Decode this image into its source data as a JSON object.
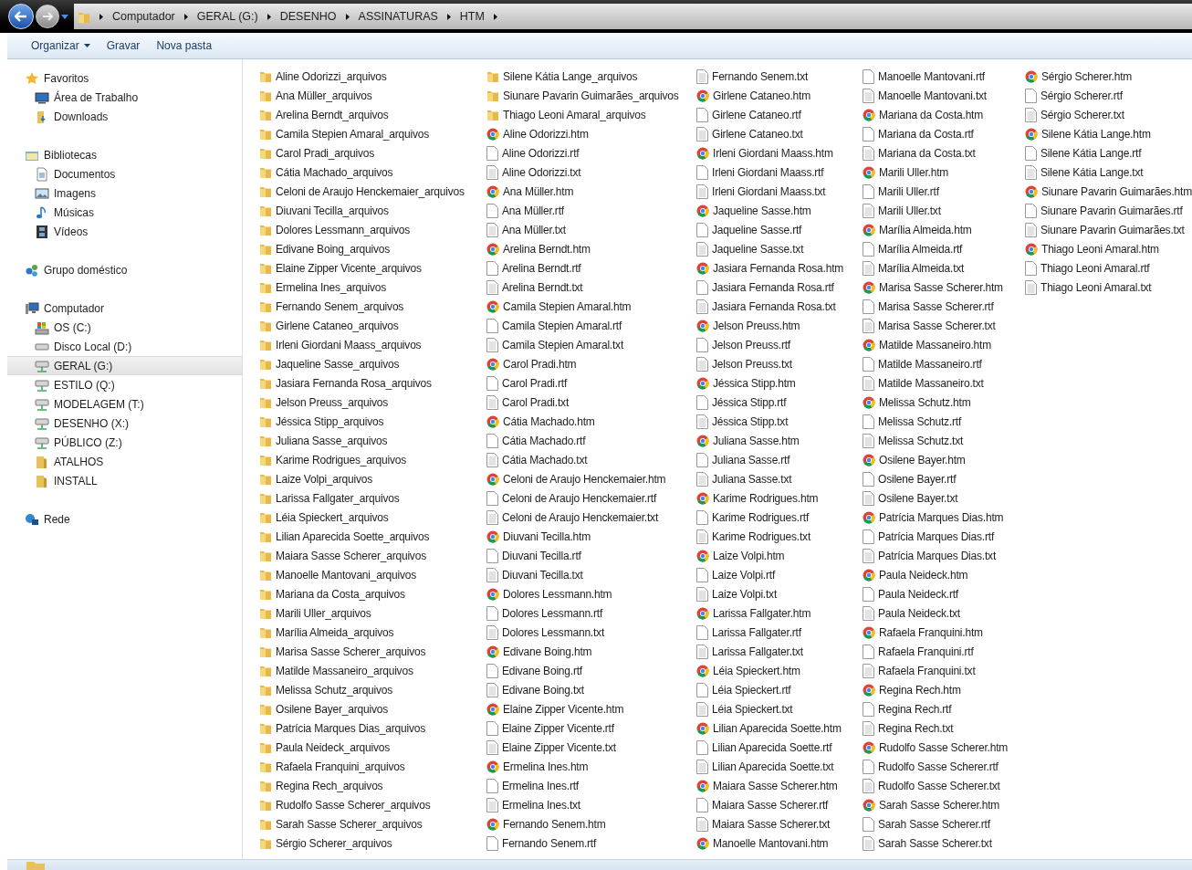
{
  "breadcrumb": [
    "Computador",
    "GERAL (G:)",
    "DESENHO",
    "ASSINATURAS",
    "HTM"
  ],
  "toolbar": [
    {
      "label": "Organizar",
      "kind": "menu"
    },
    {
      "label": "Gravar",
      "kind": "plain"
    },
    {
      "label": "Nova pasta",
      "kind": "plain"
    }
  ],
  "sidebar": [
    {
      "label": "Favoritos",
      "kind": "star",
      "selected": false,
      "children": [
        {
          "label": "Área de Trabalho",
          "kind": "desktop",
          "selected": false
        },
        {
          "label": "Downloads",
          "kind": "downloads",
          "selected": false
        }
      ]
    },
    {
      "label": "Bibliotecas",
      "kind": "library",
      "selected": false,
      "children": [
        {
          "label": "Documentos",
          "kind": "document",
          "selected": false
        },
        {
          "label": "Imagens",
          "kind": "image",
          "selected": false
        },
        {
          "label": "Músicas",
          "kind": "music",
          "selected": false
        },
        {
          "label": "Vídeos",
          "kind": "video",
          "selected": false
        }
      ]
    },
    {
      "label": "Grupo doméstico",
      "kind": "homegroup",
      "selected": false
    },
    {
      "label": "Computador",
      "kind": "computer",
      "selected": false,
      "children": [
        {
          "label": "OS (C:)",
          "kind": "osdrive",
          "selected": false
        },
        {
          "label": "Disco Local (D:)",
          "kind": "drive",
          "selected": false
        },
        {
          "label": "GERAL (G:)",
          "kind": "netdrive",
          "selected": true
        },
        {
          "label": "ESTILO (Q:)",
          "kind": "netdrive",
          "selected": false
        },
        {
          "label": "MODELAGEM (T:)",
          "kind": "netdrive",
          "selected": false
        },
        {
          "label": "DESENHO (X:)",
          "kind": "netdrive",
          "selected": false
        },
        {
          "label": "PÚBLICO (Z:)",
          "kind": "netdrive",
          "selected": false
        },
        {
          "label": "ATALHOS",
          "kind": "folder",
          "selected": false
        },
        {
          "label": "INSTALL",
          "kind": "folder",
          "selected": false
        }
      ]
    },
    {
      "label": "Rede",
      "kind": "network",
      "selected": false
    }
  ],
  "files": [
    {
      "name": "Aline Odorizzi_arquivos",
      "kind": "folder"
    },
    {
      "name": "Ana Müller_arquivos",
      "kind": "folder"
    },
    {
      "name": "Arelina Berndt_arquivos",
      "kind": "folder"
    },
    {
      "name": "Camila Stepien Amaral_arquivos",
      "kind": "folder"
    },
    {
      "name": "Carol Pradi_arquivos",
      "kind": "folder"
    },
    {
      "name": "Cátia Machado_arquivos",
      "kind": "folder"
    },
    {
      "name": "Celoni de Araujo Henckemaier_arquivos",
      "kind": "folder"
    },
    {
      "name": "Diuvani Tecilla_arquivos",
      "kind": "folder"
    },
    {
      "name": "Dolores Lessmann_arquivos",
      "kind": "folder"
    },
    {
      "name": "Edivane Boing_arquivos",
      "kind": "folder"
    },
    {
      "name": "Elaine Zipper Vicente_arquivos",
      "kind": "folder"
    },
    {
      "name": "Ermelina Ines_arquivos",
      "kind": "folder"
    },
    {
      "name": "Fernando Senem_arquivos",
      "kind": "folder"
    },
    {
      "name": "Girlene Cataneo_arquivos",
      "kind": "folder"
    },
    {
      "name": "Irleni Giordani Maass_arquivos",
      "kind": "folder"
    },
    {
      "name": "Jaqueline Sasse_arquivos",
      "kind": "folder"
    },
    {
      "name": "Jasiara Fernanda Rosa_arquivos",
      "kind": "folder"
    },
    {
      "name": "Jelson Preuss_arquivos",
      "kind": "folder"
    },
    {
      "name": "Jéssica Stipp_arquivos",
      "kind": "folder"
    },
    {
      "name": "Juliana Sasse_arquivos",
      "kind": "folder"
    },
    {
      "name": "Karime Rodrigues_arquivos",
      "kind": "folder"
    },
    {
      "name": "Laize Volpi_arquivos",
      "kind": "folder"
    },
    {
      "name": "Larissa Fallgater_arquivos",
      "kind": "folder"
    },
    {
      "name": "Léia Spieckert_arquivos",
      "kind": "folder"
    },
    {
      "name": "Lilian Aparecida Soette_arquivos",
      "kind": "folder"
    },
    {
      "name": "Maiara Sasse Scherer_arquivos",
      "kind": "folder"
    },
    {
      "name": "Manoelle Mantovani_arquivos",
      "kind": "folder"
    },
    {
      "name": "Mariana da Costa_arquivos",
      "kind": "folder"
    },
    {
      "name": "Marili Uller_arquivos",
      "kind": "folder"
    },
    {
      "name": "Marília Almeida_arquivos",
      "kind": "folder"
    },
    {
      "name": "Marisa Sasse Scherer_arquivos",
      "kind": "folder"
    },
    {
      "name": "Matilde Massaneiro_arquivos",
      "kind": "folder"
    },
    {
      "name": "Melissa Schutz_arquivos",
      "kind": "folder"
    },
    {
      "name": "Osilene Bayer_arquivos",
      "kind": "folder"
    },
    {
      "name": "Patrícia Marques Dias_arquivos",
      "kind": "folder"
    },
    {
      "name": "Paula Neideck_arquivos",
      "kind": "folder"
    },
    {
      "name": "Rafaela Franquini_arquivos",
      "kind": "folder"
    },
    {
      "name": "Regina Rech_arquivos",
      "kind": "folder"
    },
    {
      "name": "Rudolfo Sasse Scherer_arquivos",
      "kind": "folder"
    },
    {
      "name": "Sarah Sasse Scherer_arquivos",
      "kind": "folder"
    },
    {
      "name": "Sérgio Scherer_arquivos",
      "kind": "folder"
    },
    {
      "name": "Silene Kátia Lange_arquivos",
      "kind": "folder"
    },
    {
      "name": "Siunare Pavarin Guimarães_arquivos",
      "kind": "folder"
    },
    {
      "name": "Thiago Leoni Amaral_arquivos",
      "kind": "folder"
    },
    {
      "name": "Aline Odorizzi.htm",
      "kind": "htm"
    },
    {
      "name": "Aline Odorizzi.rtf",
      "kind": "rtf"
    },
    {
      "name": "Aline Odorizzi.txt",
      "kind": "txt"
    },
    {
      "name": "Ana Müller.htm",
      "kind": "htm"
    },
    {
      "name": "Ana Müller.rtf",
      "kind": "rtf"
    },
    {
      "name": "Ana Müller.txt",
      "kind": "txt"
    },
    {
      "name": "Arelina Berndt.htm",
      "kind": "htm"
    },
    {
      "name": "Arelina Berndt.rtf",
      "kind": "rtf"
    },
    {
      "name": "Arelina Berndt.txt",
      "kind": "txt"
    },
    {
      "name": "Camila Stepien Amaral.htm",
      "kind": "htm"
    },
    {
      "name": "Camila Stepien Amaral.rtf",
      "kind": "rtf"
    },
    {
      "name": "Camila Stepien Amaral.txt",
      "kind": "txt"
    },
    {
      "name": "Carol Pradi.htm",
      "kind": "htm"
    },
    {
      "name": "Carol Pradi.rtf",
      "kind": "rtf"
    },
    {
      "name": "Carol Pradi.txt",
      "kind": "txt"
    },
    {
      "name": "Cátia Machado.htm",
      "kind": "htm"
    },
    {
      "name": "Cátia Machado.rtf",
      "kind": "rtf"
    },
    {
      "name": "Cátia Machado.txt",
      "kind": "txt"
    },
    {
      "name": "Celoni de Araujo Henckemaier.htm",
      "kind": "htm"
    },
    {
      "name": "Celoni de Araujo Henckemaier.rtf",
      "kind": "rtf"
    },
    {
      "name": "Celoni de Araujo Henckemaier.txt",
      "kind": "txt"
    },
    {
      "name": "Diuvani Tecilla.htm",
      "kind": "htm"
    },
    {
      "name": "Diuvani Tecilla.rtf",
      "kind": "rtf"
    },
    {
      "name": "Diuvani Tecilla.txt",
      "kind": "txt"
    },
    {
      "name": "Dolores Lessmann.htm",
      "kind": "htm"
    },
    {
      "name": "Dolores Lessmann.rtf",
      "kind": "rtf"
    },
    {
      "name": "Dolores Lessmann.txt",
      "kind": "txt"
    },
    {
      "name": "Edivane Boing.htm",
      "kind": "htm"
    },
    {
      "name": "Edivane Boing.rtf",
      "kind": "rtf"
    },
    {
      "name": "Edivane Boing.txt",
      "kind": "txt"
    },
    {
      "name": "Elaine Zipper Vicente.htm",
      "kind": "htm"
    },
    {
      "name": "Elaine Zipper Vicente.rtf",
      "kind": "rtf"
    },
    {
      "name": "Elaine Zipper Vicente.txt",
      "kind": "txt"
    },
    {
      "name": "Ermelina Ines.htm",
      "kind": "htm"
    },
    {
      "name": "Ermelina Ines.rtf",
      "kind": "rtf"
    },
    {
      "name": "Ermelina Ines.txt",
      "kind": "txt"
    },
    {
      "name": "Fernando Senem.htm",
      "kind": "htm"
    },
    {
      "name": "Fernando Senem.rtf",
      "kind": "rtf"
    },
    {
      "name": "Fernando Senem.txt",
      "kind": "txt"
    },
    {
      "name": "Girlene Cataneo.htm",
      "kind": "htm"
    },
    {
      "name": "Girlene Cataneo.rtf",
      "kind": "rtf"
    },
    {
      "name": "Girlene Cataneo.txt",
      "kind": "txt"
    },
    {
      "name": "Irleni Giordani Maass.htm",
      "kind": "htm"
    },
    {
      "name": "Irleni Giordani Maass.rtf",
      "kind": "rtf"
    },
    {
      "name": "Irleni Giordani Maass.txt",
      "kind": "txt"
    },
    {
      "name": "Jaqueline Sasse.htm",
      "kind": "htm"
    },
    {
      "name": "Jaqueline Sasse.rtf",
      "kind": "rtf"
    },
    {
      "name": "Jaqueline Sasse.txt",
      "kind": "txt"
    },
    {
      "name": "Jasiara Fernanda Rosa.htm",
      "kind": "htm"
    },
    {
      "name": "Jasiara Fernanda Rosa.rtf",
      "kind": "rtf"
    },
    {
      "name": "Jasiara Fernanda Rosa.txt",
      "kind": "txt"
    },
    {
      "name": "Jelson Preuss.htm",
      "kind": "htm"
    },
    {
      "name": "Jelson Preuss.rtf",
      "kind": "rtf"
    },
    {
      "name": "Jelson Preuss.txt",
      "kind": "txt"
    },
    {
      "name": "Jéssica Stipp.htm",
      "kind": "htm"
    },
    {
      "name": "Jéssica Stipp.rtf",
      "kind": "rtf"
    },
    {
      "name": "Jéssica Stipp.txt",
      "kind": "txt"
    },
    {
      "name": "Juliana Sasse.htm",
      "kind": "htm"
    },
    {
      "name": "Juliana Sasse.rtf",
      "kind": "rtf"
    },
    {
      "name": "Juliana Sasse.txt",
      "kind": "txt"
    },
    {
      "name": "Karime Rodrigues.htm",
      "kind": "htm"
    },
    {
      "name": "Karime Rodrigues.rtf",
      "kind": "rtf"
    },
    {
      "name": "Karime Rodrigues.txt",
      "kind": "txt"
    },
    {
      "name": "Laize Volpi.htm",
      "kind": "htm"
    },
    {
      "name": "Laize Volpi.rtf",
      "kind": "rtf"
    },
    {
      "name": "Laize Volpi.txt",
      "kind": "txt"
    },
    {
      "name": "Larissa Fallgater.htm",
      "kind": "htm"
    },
    {
      "name": "Larissa Fallgater.rtf",
      "kind": "rtf"
    },
    {
      "name": "Larissa Fallgater.txt",
      "kind": "txt"
    },
    {
      "name": "Léia Spieckert.htm",
      "kind": "htm"
    },
    {
      "name": "Léia Spieckert.rtf",
      "kind": "rtf"
    },
    {
      "name": "Léia Spieckert.txt",
      "kind": "txt"
    },
    {
      "name": "Lilian Aparecida Soette.htm",
      "kind": "htm"
    },
    {
      "name": "Lilian Aparecida Soette.rtf",
      "kind": "rtf"
    },
    {
      "name": "Lilian Aparecida Soette.txt",
      "kind": "txt"
    },
    {
      "name": "Maiara Sasse Scherer.htm",
      "kind": "htm"
    },
    {
      "name": "Maiara Sasse Scherer.rtf",
      "kind": "rtf"
    },
    {
      "name": "Maiara Sasse Scherer.txt",
      "kind": "txt"
    },
    {
      "name": "Manoelle Mantovani.htm",
      "kind": "htm"
    },
    {
      "name": "Manoelle Mantovani.rtf",
      "kind": "rtf"
    },
    {
      "name": "Manoelle Mantovani.txt",
      "kind": "txt"
    },
    {
      "name": "Mariana da Costa.htm",
      "kind": "htm"
    },
    {
      "name": "Mariana da Costa.rtf",
      "kind": "rtf"
    },
    {
      "name": "Mariana da Costa.txt",
      "kind": "txt"
    },
    {
      "name": "Marili Uller.htm",
      "kind": "htm"
    },
    {
      "name": "Marili Uller.rtf",
      "kind": "rtf"
    },
    {
      "name": "Marili Uller.txt",
      "kind": "txt"
    },
    {
      "name": "Marília Almeida.htm",
      "kind": "htm"
    },
    {
      "name": "Marília Almeida.rtf",
      "kind": "rtf"
    },
    {
      "name": "Marília Almeida.txt",
      "kind": "txt"
    },
    {
      "name": "Marisa Sasse Scherer.htm",
      "kind": "htm"
    },
    {
      "name": "Marisa Sasse Scherer.rtf",
      "kind": "rtf"
    },
    {
      "name": "Marisa Sasse Scherer.txt",
      "kind": "txt"
    },
    {
      "name": "Matilde Massaneiro.htm",
      "kind": "htm"
    },
    {
      "name": "Matilde Massaneiro.rtf",
      "kind": "rtf"
    },
    {
      "name": "Matilde Massaneiro.txt",
      "kind": "txt"
    },
    {
      "name": "Melissa Schutz.htm",
      "kind": "htm"
    },
    {
      "name": "Melissa Schutz.rtf",
      "kind": "rtf"
    },
    {
      "name": "Melissa Schutz.txt",
      "kind": "txt"
    },
    {
      "name": "Osilene Bayer.htm",
      "kind": "htm"
    },
    {
      "name": "Osilene Bayer.rtf",
      "kind": "rtf"
    },
    {
      "name": "Osilene Bayer.txt",
      "kind": "txt"
    },
    {
      "name": "Patrícia Marques Dias.htm",
      "kind": "htm"
    },
    {
      "name": "Patrícia Marques Dias.rtf",
      "kind": "rtf"
    },
    {
      "name": "Patrícia Marques Dias.txt",
      "kind": "txt"
    },
    {
      "name": "Paula Neideck.htm",
      "kind": "htm"
    },
    {
      "name": "Paula Neideck.rtf",
      "kind": "rtf"
    },
    {
      "name": "Paula Neideck.txt",
      "kind": "txt"
    },
    {
      "name": "Rafaela Franquini.htm",
      "kind": "htm"
    },
    {
      "name": "Rafaela Franquini.rtf",
      "kind": "rtf"
    },
    {
      "name": "Rafaela Franquini.txt",
      "kind": "txt"
    },
    {
      "name": "Regina Rech.htm",
      "kind": "htm"
    },
    {
      "name": "Regina Rech.rtf",
      "kind": "rtf"
    },
    {
      "name": "Regina Rech.txt",
      "kind": "txt"
    },
    {
      "name": "Rudolfo Sasse Scherer.htm",
      "kind": "htm"
    },
    {
      "name": "Rudolfo Sasse Scherer.rtf",
      "kind": "rtf"
    },
    {
      "name": "Rudolfo Sasse Scherer.txt",
      "kind": "txt"
    },
    {
      "name": "Sarah Sasse Scherer.htm",
      "kind": "htm"
    },
    {
      "name": "Sarah Sasse Scherer.rtf",
      "kind": "rtf"
    },
    {
      "name": "Sarah Sasse Scherer.txt",
      "kind": "txt"
    },
    {
      "name": "Sérgio Scherer.htm",
      "kind": "htm"
    },
    {
      "name": "Sérgio Scherer.rtf",
      "kind": "rtf"
    },
    {
      "name": "Sérgio Scherer.txt",
      "kind": "txt"
    },
    {
      "name": "Silene Kátia Lange.htm",
      "kind": "htm"
    },
    {
      "name": "Silene Kátia Lange.rtf",
      "kind": "rtf"
    },
    {
      "name": "Silene Kátia Lange.txt",
      "kind": "txt"
    },
    {
      "name": "Siunare Pavarin Guimarães.htm",
      "kind": "htm"
    },
    {
      "name": "Siunare Pavarin Guimarães.rtf",
      "kind": "rtf"
    },
    {
      "name": "Siunare Pavarin Guimarães.txt",
      "kind": "txt"
    },
    {
      "name": "Thiago Leoni Amaral.htm",
      "kind": "htm"
    },
    {
      "name": "Thiago Leoni Amaral.rtf",
      "kind": "rtf"
    },
    {
      "name": "Thiago Leoni Amaral.txt",
      "kind": "txt"
    }
  ]
}
